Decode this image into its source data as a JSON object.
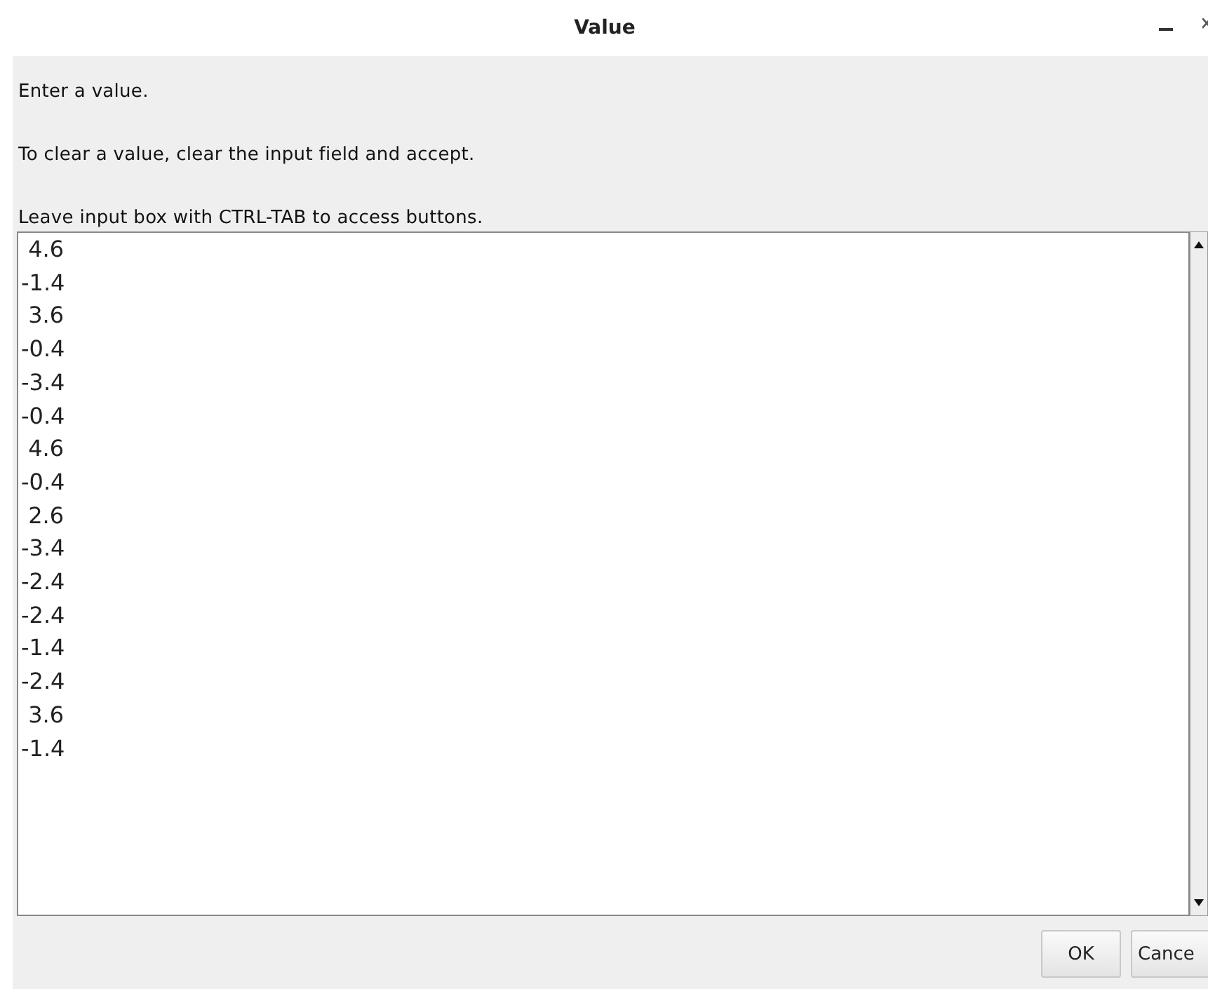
{
  "window": {
    "title": "Value"
  },
  "messages": [
    "Enter a value.",
    "To clear a value, clear the input field and accept.",
    "Leave input box with CTRL-TAB to access buttons."
  ],
  "input": {
    "lines": [
      " 4.6",
      "-1.4",
      " 3.6",
      "-0.4",
      "-3.4",
      "-0.4",
      " 4.6",
      "-0.4",
      " 2.6",
      "-3.4",
      "-2.4",
      "-2.4",
      "-1.4",
      "-2.4",
      " 3.6",
      "-1.4"
    ]
  },
  "buttons": [
    "OK",
    "Cance"
  ]
}
